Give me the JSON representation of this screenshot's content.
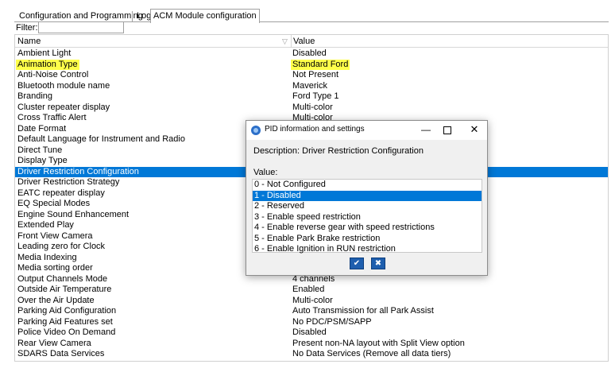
{
  "tabs": [
    {
      "label": "Configuration and Programming"
    },
    {
      "label": "Log"
    },
    {
      "label": "ACM Module configuration"
    }
  ],
  "filter": {
    "label": "Filter:",
    "value": ""
  },
  "columns": {
    "name": "Name",
    "value": "Value"
  },
  "rows": [
    {
      "name": "Ambient Light",
      "value": "Disabled"
    },
    {
      "name": "Animation Type",
      "value": "Standard Ford"
    },
    {
      "name": "Anti-Noise Control",
      "value": "Not Present"
    },
    {
      "name": "Bluetooth module name",
      "value": "Maverick"
    },
    {
      "name": "Branding",
      "value": "Ford Type 1"
    },
    {
      "name": "Cluster repeater display",
      "value": "Multi-color"
    },
    {
      "name": "Cross Traffic Alert",
      "value": "Multi-color"
    },
    {
      "name": "Date Format",
      "value": ""
    },
    {
      "name": "Default Language for Instrument and Radio",
      "value": ""
    },
    {
      "name": "Direct Tune",
      "value": ""
    },
    {
      "name": "Display Type",
      "value": ""
    },
    {
      "name": "Driver Restriction Configuration",
      "value": ""
    },
    {
      "name": "Driver Restriction Strategy",
      "value": ""
    },
    {
      "name": "EATC repeater display",
      "value": ""
    },
    {
      "name": "EQ Special Modes",
      "value": ""
    },
    {
      "name": "Engine Sound Enhancement",
      "value": ""
    },
    {
      "name": "Extended Play",
      "value": ""
    },
    {
      "name": "Front View Camera",
      "value": ""
    },
    {
      "name": "Leading zero for Clock",
      "value": ""
    },
    {
      "name": "Media Indexing",
      "value": ""
    },
    {
      "name": "Media sorting order",
      "value": ""
    },
    {
      "name": "Output Channels Mode",
      "value": "4 channels"
    },
    {
      "name": "Outside Air Temperature",
      "value": "Enabled"
    },
    {
      "name": "Over the Air Update",
      "value": "Multi-color"
    },
    {
      "name": "Parking Aid Configuration",
      "value": "Auto Transmission for all Park Assist"
    },
    {
      "name": "Parking Aid Features set",
      "value": "No PDC/PSM/SAPP"
    },
    {
      "name": "Police Video On Demand",
      "value": "Disabled"
    },
    {
      "name": "Rear View Camera",
      "value": "Present non-NA layout with Split View option"
    },
    {
      "name": "SDARS Data Services",
      "value": "No Data Services (Remove all data tiers)"
    }
  ],
  "selected_row": "Driver Restriction Configuration",
  "highlighted_rows": [
    "Animation Type"
  ],
  "colors": {
    "selection": "#0078d7",
    "highlight": "#ffff4a",
    "button": "#1f5fae"
  },
  "dialog": {
    "title": "PID information and settings",
    "description": "Description: Driver Restriction Configuration",
    "value_label": "Value:",
    "options": [
      "0 - Not Configured",
      "1 - Disabled",
      "2 - Reserved",
      "3 - Enable speed restriction",
      "4 - Enable reverse gear with speed restrictions",
      "5 - Enable Park Brake restriction",
      "6 - Enable Ignition in RUN restriction"
    ],
    "selected_option": "1 - Disabled",
    "ok_icon": "checkmark-icon",
    "cancel_icon": "x-icon"
  }
}
